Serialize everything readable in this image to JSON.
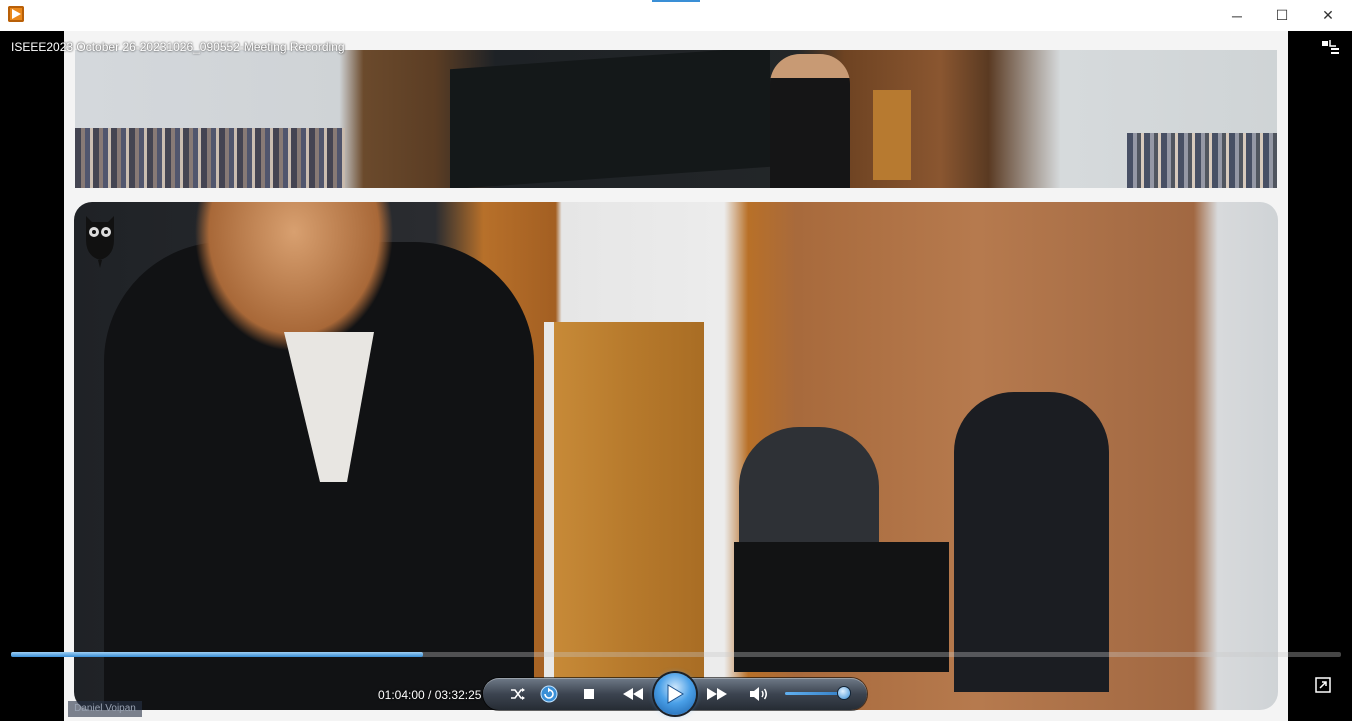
{
  "window": {
    "title": "ISEEE2023 October 26-20231026_090552-Meeting Recording",
    "minimize": "─",
    "maximize": "☐",
    "close": "✕"
  },
  "video": {
    "speaker_name_tag": "Daniel Voipan"
  },
  "playback": {
    "current_time": "01:04:00",
    "total_time": "03:32:25",
    "time_display": "01:04:00 / 03:32:25",
    "progress": 0.31,
    "volume": 0.9
  },
  "colors": {
    "accent": "#3a8fd6",
    "titlebar_bg": "#ffffff",
    "video_bg": "#000000"
  },
  "icons": {
    "app": "media-player-icon",
    "collapse": "collapse-icon",
    "shuffle": "shuffle-icon",
    "repeat": "repeat-icon",
    "stop": "stop-icon",
    "previous": "rewind-icon",
    "play": "play-icon",
    "next": "fast-forward-icon",
    "volume": "volume-icon",
    "fullscreen": "fullscreen-icon"
  }
}
